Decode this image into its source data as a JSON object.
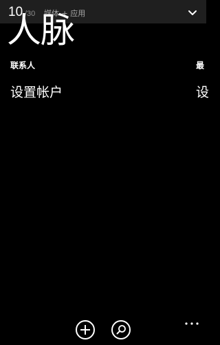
{
  "status_bar": {
    "progress_current": "10",
    "progress_total": "/30",
    "category": "媒体 + 应用",
    "expand_icon": "chevron-down-icon"
  },
  "hub": {
    "title": "人脉",
    "sections": [
      {
        "header": "联系人",
        "link": "设置帐户"
      },
      {
        "header": "最",
        "link": "设"
      }
    ]
  },
  "app_bar": {
    "buttons": [
      {
        "icon": "add-icon"
      },
      {
        "icon": "search-icon"
      }
    ],
    "more_icon": "more-icon"
  },
  "colors": {
    "background": "#000000",
    "topbar": "#1f1f1f",
    "text": "#ffffff",
    "muted": "#a6a6a6"
  }
}
